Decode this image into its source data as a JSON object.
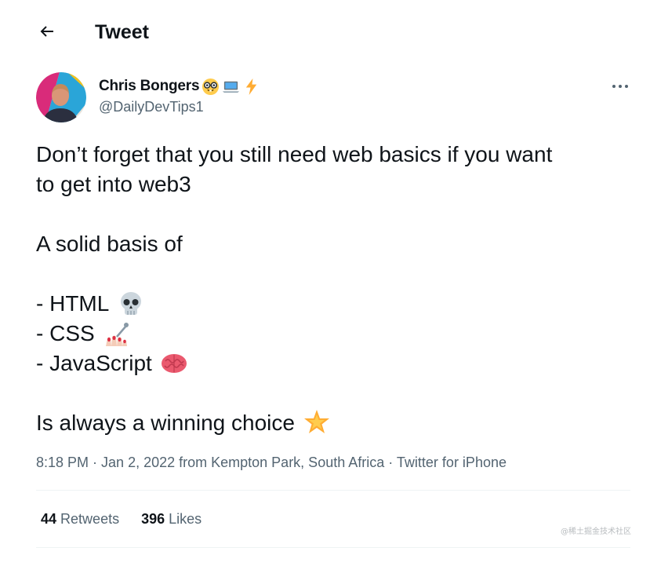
{
  "header": {
    "back_icon": "arrow-left-icon",
    "title": "Tweet"
  },
  "author": {
    "name": "Chris Bongers",
    "name_emojis": [
      "nerd-face-emoji",
      "laptop-emoji",
      "lightning-emoji"
    ],
    "handle": "@DailyDevTips1"
  },
  "tweet": {
    "line1": "Don’t forget that you still need web basics if you want",
    "line2": "to get into web3",
    "line3": "A solid basis of",
    "list": [
      {
        "text": "- HTML",
        "emoji": "skull-emoji"
      },
      {
        "text": "- CSS",
        "emoji": "nail-polish-emoji"
      },
      {
        "text": "- JavaScript",
        "emoji": "brain-emoji"
      }
    ],
    "closing": "Is always a winning choice",
    "closing_emoji": "glowing-star-emoji"
  },
  "meta": {
    "time": "8:18 PM",
    "sep1": " · ",
    "date": "Jan 2, 2022",
    "location": " from Kempton Park, South Africa",
    "sep2": " · ",
    "source": "Twitter for iPhone"
  },
  "stats": {
    "retweets_count": "44",
    "retweets_label": "Retweets",
    "likes_count": "396",
    "likes_label": "Likes"
  },
  "watermark": "@稀土掘金技术社区",
  "colors": {
    "text": "#0f1419",
    "secondary": "#536471",
    "divider": "#eff3f4"
  }
}
